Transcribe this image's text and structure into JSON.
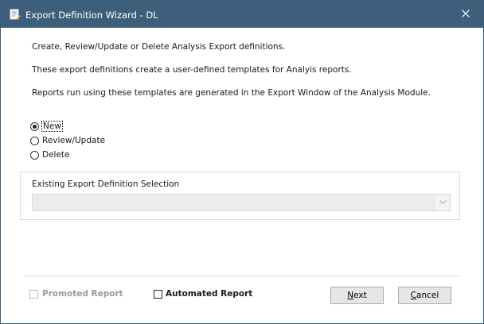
{
  "window": {
    "title": "Export Definition Wizard - DL",
    "icon": "wizard-document-icon",
    "close_icon": "close-icon",
    "colors": {
      "titlebar": "#3d5f7c",
      "title_text": "#ffffff"
    }
  },
  "intro": {
    "line1": "Create, Review/Update or Delete Analysis Export definitions.",
    "line2": "These export definitions create a user-defined templates for Analyis reports.",
    "line3": "Reports run using these templates are generated in the Export Window of the Analysis Module."
  },
  "options": {
    "new": {
      "label": "New",
      "selected": true
    },
    "review": {
      "label": "Review/Update",
      "selected": false
    },
    "delete": {
      "label": "Delete",
      "selected": false
    }
  },
  "selection": {
    "title": "Existing Export Definition Selection",
    "value": "",
    "enabled": false
  },
  "footer": {
    "promoted": {
      "label": "Promoted Report",
      "checked": false,
      "enabled": false
    },
    "automated": {
      "label": "Automated Report",
      "checked": false,
      "enabled": true
    },
    "next": {
      "mnemonic": "N",
      "rest": "ext"
    },
    "cancel": {
      "mnemonic": "C",
      "rest": "ancel"
    }
  }
}
